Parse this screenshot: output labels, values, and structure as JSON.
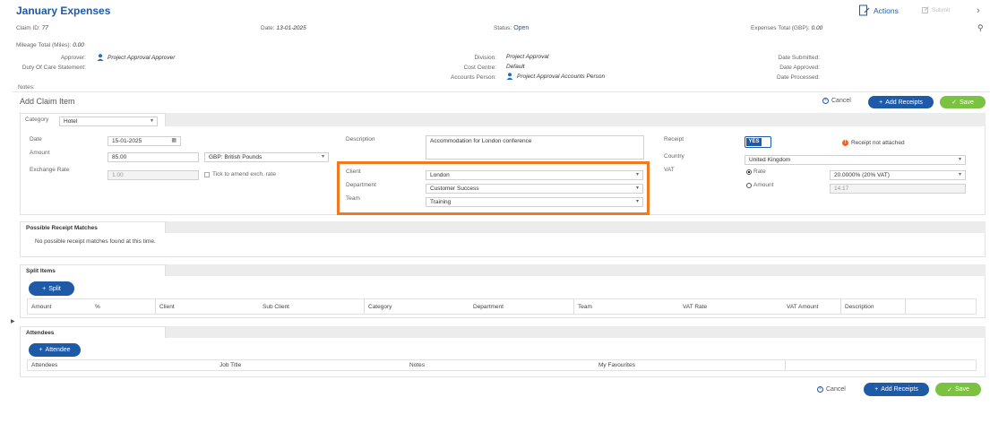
{
  "header": {
    "title": "January Expenses",
    "actions_label": "Actions",
    "submit_label": "Submit"
  },
  "claim": {
    "claim_id_label": "Claim ID:",
    "claim_id": "77",
    "date_label": "Date:",
    "date": "13-01-2025",
    "status_label": "Status:",
    "status": "Open",
    "expenses_total_label": "Expenses Total (GBP):",
    "expenses_total": "0.00",
    "mileage_label": "Mileage Total (Miles):",
    "mileage": "0.00",
    "approver_label": "Approver:",
    "approver": "Project Approval Approver",
    "duty_label": "Duty Of Care Statement:",
    "division_label": "Division:",
    "division": "Project Approval",
    "cost_centre_label": "Cost Centre:",
    "cost_centre": "Default",
    "accounts_label": "Accounts Person:",
    "accounts": "Project Approval Accounts Person",
    "date_submitted_label": "Date Submitted:",
    "date_approved_label": "Date Approved:",
    "date_processed_label": "Date Processed:",
    "notes_label": "Notes:"
  },
  "add_item": {
    "title": "Add Claim Item",
    "cancel_label": "Cancel",
    "add_receipts_label": "Add Receipts",
    "save_label": "Save",
    "category_label": "Category",
    "category_value": "Hotel",
    "date_label": "Date",
    "date_value": "15-01-2025",
    "amount_label": "Amount",
    "amount_value": "85.00",
    "currency_value": "GBP: British Pounds",
    "exchange_label": "Exchange Rate",
    "exchange_value": "1.00",
    "amend_label": "Tick to amend exch. rate",
    "description_label": "Description",
    "description_value": "Accommodation for London conference",
    "client_label": "Client",
    "client_value": "London",
    "department_label": "Department",
    "department_value": "Customer Success",
    "team_label": "Team",
    "team_value": "Training",
    "receipt_label": "Receipt",
    "receipt_toggle": "YES",
    "receipt_warning": "Receipt not attached",
    "country_label": "Country",
    "country_value": "United Kingdom",
    "vat_label": "VAT",
    "rate_label": "Rate",
    "rate_value": "20.0000% (20% VAT)",
    "vat_amount_label": "Amount",
    "vat_amount_value": "14.17"
  },
  "receipt_matches": {
    "title": "Possible Receipt Matches",
    "empty": "No possible receipt matches found at this time."
  },
  "split_items": {
    "title": "Split Items",
    "split_button": "Split",
    "columns": [
      "Amount",
      "%",
      "Client",
      "Sub Client",
      "Category",
      "Department",
      "Team",
      "VAT Rate",
      "VAT Amount",
      "Description"
    ]
  },
  "attendees": {
    "title": "Attendees",
    "add_button": "Attendee",
    "columns": [
      "Attendees",
      "Job Title",
      "Notes",
      "My Favourites"
    ]
  },
  "footer": {
    "cancel_label": "Cancel",
    "add_receipts_label": "Add Receipts",
    "save_label": "Save"
  },
  "colors": {
    "primary": "#1f5aa6",
    "success": "#7cc242",
    "highlight": "#f07a22",
    "warning": "#e8672f"
  }
}
